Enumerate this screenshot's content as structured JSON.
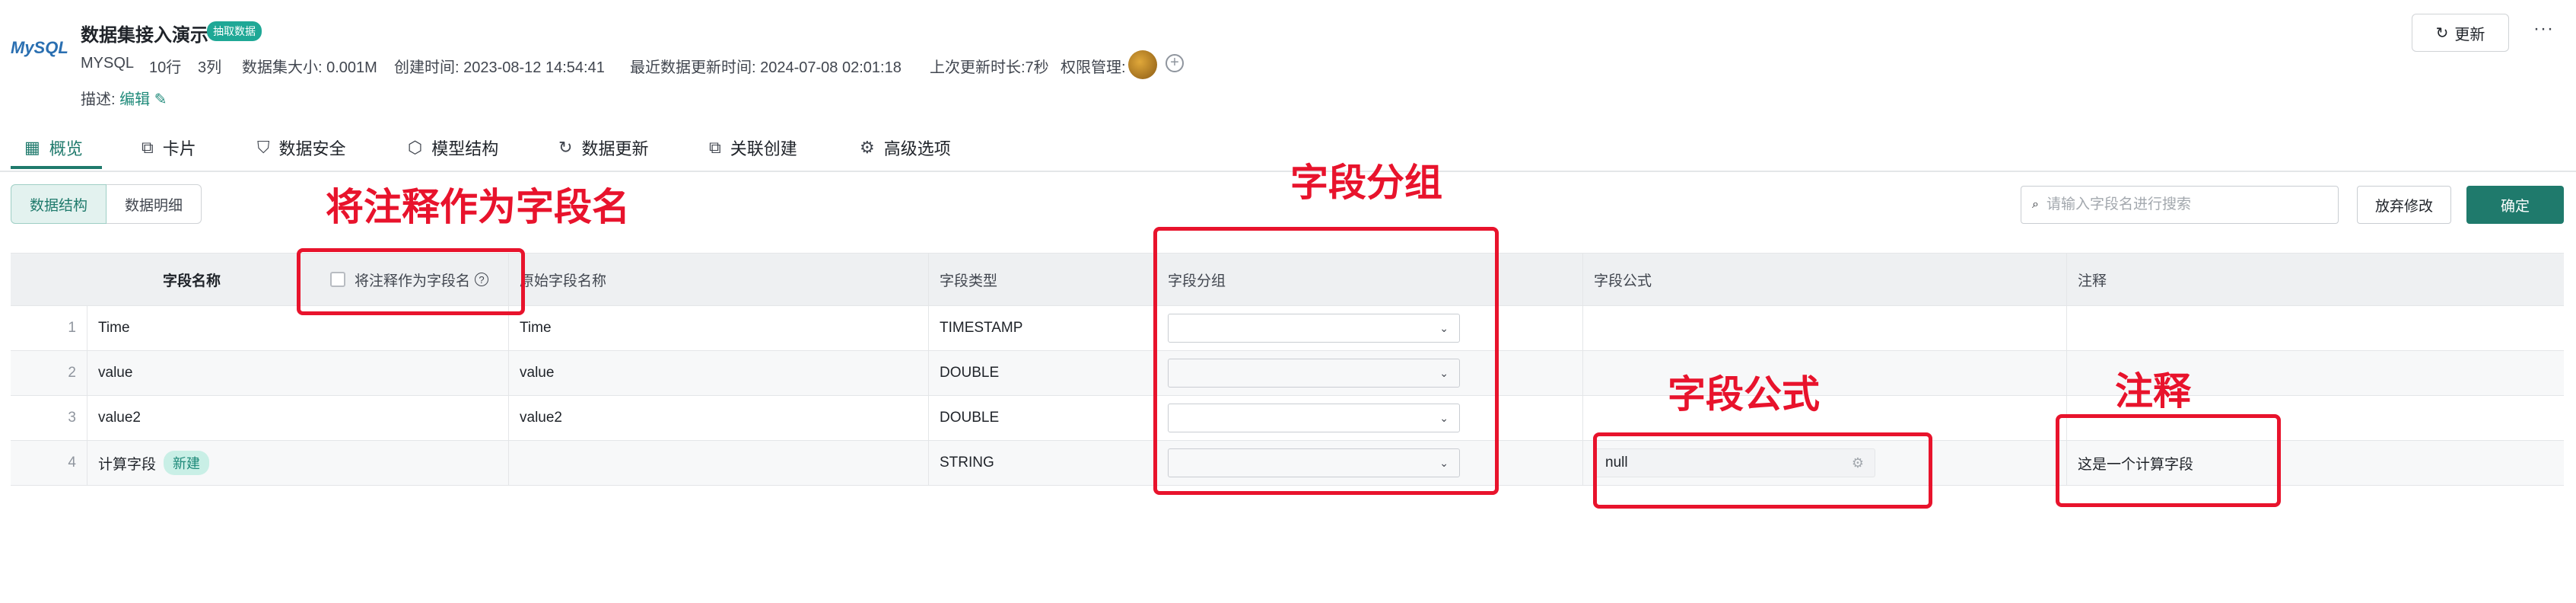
{
  "header": {
    "logo_text": "MySQL",
    "title": "数据集接入演示",
    "badge": "抽取数据",
    "meta": {
      "db_type": "MYSQL",
      "rows": "10行",
      "cols": "3列",
      "size": "数据集大小: 0.001M",
      "created": "创建时间: 2023-08-12 14:54:41",
      "updated": "最近数据更新时间: 2024-07-08 02:01:18",
      "last_duration": "上次更新时长:7秒",
      "permission": "权限管理:"
    },
    "description_label": "描述:",
    "description_edit": "编辑",
    "refresh_label": "更新",
    "more": "···"
  },
  "tabs": [
    {
      "icon": "▦",
      "label": "概览",
      "active": true
    },
    {
      "icon": "⧉",
      "label": "卡片"
    },
    {
      "icon": "⛉",
      "label": "数据安全"
    },
    {
      "icon": "⬡",
      "label": "模型结构"
    },
    {
      "icon": "↻",
      "label": "数据更新"
    },
    {
      "icon": "⧉",
      "label": "关联创建"
    },
    {
      "icon": "⚙",
      "label": "高级选项"
    }
  ],
  "view_toggle": {
    "structure": "数据结构",
    "detail": "数据明细"
  },
  "search": {
    "placeholder": "请输入字段名进行搜索"
  },
  "actions": {
    "discard": "放弃修改",
    "confirm": "确定"
  },
  "table": {
    "headers": {
      "field_name": "字段名称",
      "comment_as_name": "将注释作为字段名",
      "original_name": "原始字段名称",
      "type": "字段类型",
      "group": "字段分组",
      "formula": "字段公式",
      "comment": "注释"
    },
    "rows": [
      {
        "idx": "1",
        "name": "Time",
        "original": "Time",
        "type": "TIMESTAMP",
        "formula": "",
        "comment": ""
      },
      {
        "idx": "2",
        "name": "value",
        "original": "value",
        "type": "DOUBLE",
        "formula": "",
        "comment": ""
      },
      {
        "idx": "3",
        "name": "value2",
        "original": "value2",
        "type": "DOUBLE",
        "formula": "",
        "comment": ""
      },
      {
        "idx": "4",
        "name": "计算字段",
        "tag": "新建",
        "original": "",
        "type": "STRING",
        "formula": "null",
        "comment": "这是一个计算字段"
      }
    ]
  },
  "annotations": {
    "comment_as_name": "将注释作为字段名",
    "group": "字段分组",
    "formula": "字段公式",
    "comment": "注释",
    "color": "#e8132c"
  }
}
